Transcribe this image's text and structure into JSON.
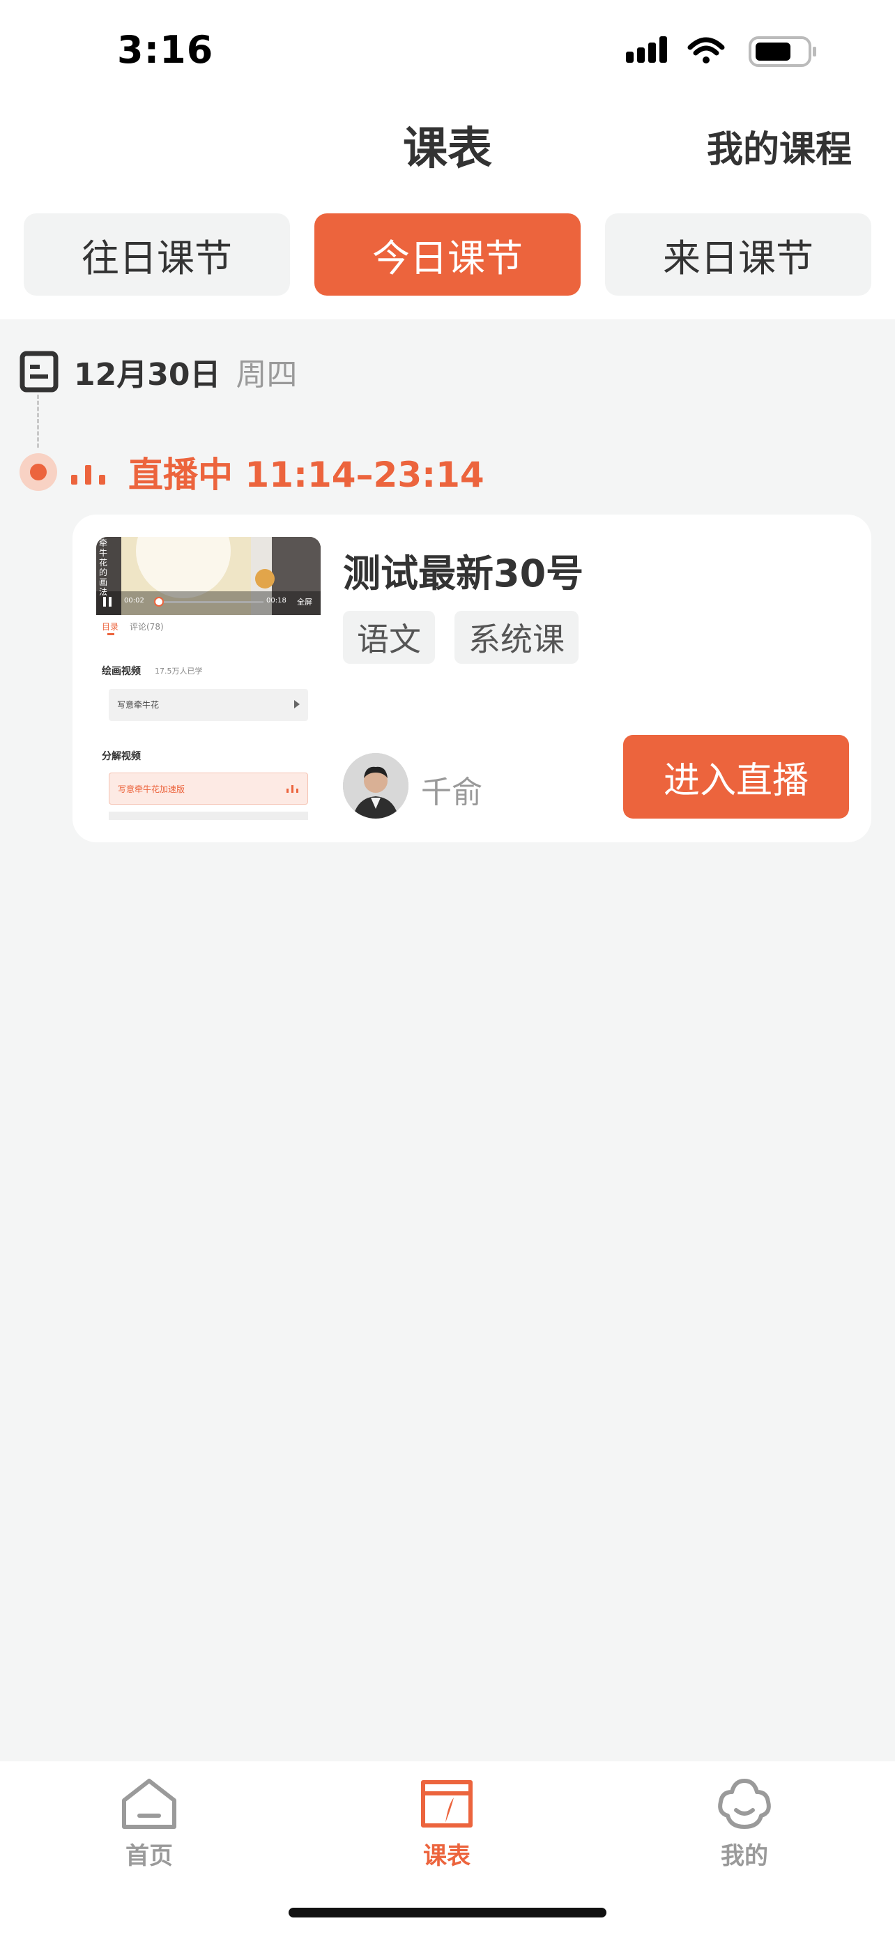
{
  "status_bar": {
    "time": "3:16"
  },
  "nav": {
    "title": "课表",
    "right_link": "我的课程"
  },
  "tabs": [
    {
      "label": "往日课节",
      "active": false
    },
    {
      "label": "今日课节",
      "active": true
    },
    {
      "label": "来日课节",
      "active": false
    }
  ],
  "schedule": {
    "date": "12月30日",
    "weekday": "周四",
    "live_status": "直播中 11:14–23:14"
  },
  "course_card": {
    "title": "测试最新30号",
    "tags": [
      "语文",
      "系统课"
    ],
    "teacher_name": "千俞",
    "enter_button": "进入直播",
    "thumbnail": {
      "video_caption": "牵牛花的画法",
      "time_current": "00:02",
      "time_total": "00:18",
      "fullscreen": "全屏",
      "tab_catalog": "目录",
      "tab_comments": "评论(78)",
      "section1_title": "绘画视频",
      "section1_count": "17.5万人已学",
      "section1_item": "写意牵牛花",
      "section2_title": "分解视频",
      "section2_item": "写意牵牛花加速版"
    }
  },
  "tabbar": [
    {
      "label": "首页",
      "icon": "home-icon",
      "active": false
    },
    {
      "label": "课表",
      "icon": "schedule-icon",
      "active": true
    },
    {
      "label": "我的",
      "icon": "profile-icon",
      "active": false
    }
  ],
  "colors": {
    "accent": "#ec643d",
    "accent_light": "#f8d2c4",
    "background": "#f4f5f5"
  }
}
